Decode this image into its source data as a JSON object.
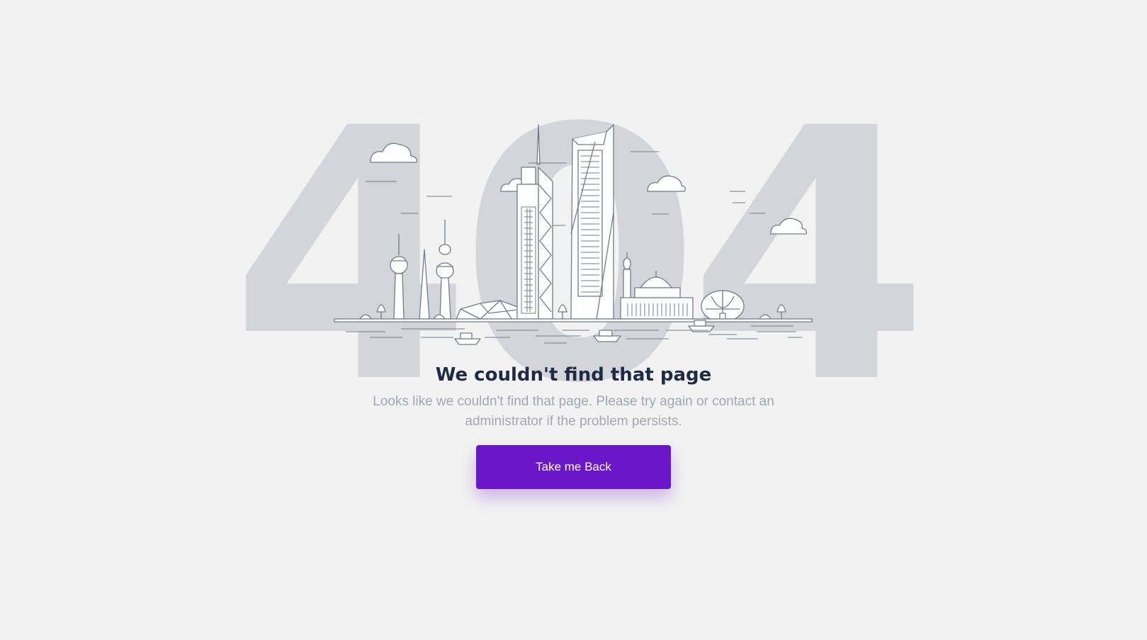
{
  "hero": {
    "code": "404",
    "title": "We couldn't find that page",
    "message": "Looks like we couldn't find that page. Please try again or contact an administrator if the problem persists."
  },
  "actions": {
    "back_label": "Take me Back"
  },
  "colors": {
    "background": "#f2f2f2",
    "digits": "#d4d5da",
    "title": "#1f2a44",
    "message": "#a4a7b3",
    "accent": "#6a17c9",
    "line_art": "#6f7d8a"
  },
  "icons": [
    "city-skyline-illustration"
  ]
}
